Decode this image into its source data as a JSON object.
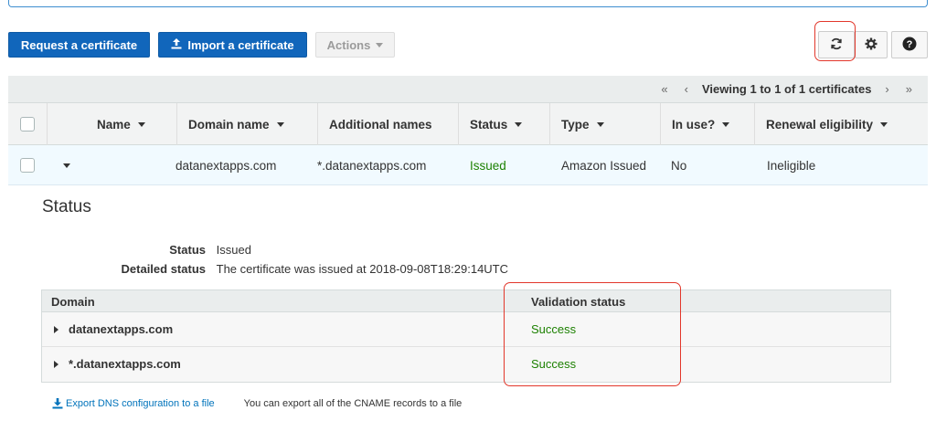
{
  "toolbar": {
    "request_label": "Request a certificate",
    "import_label": "Import a certificate",
    "actions_label": "Actions",
    "refresh_icon": "↻",
    "settings_icon": "✱",
    "help_icon": "?"
  },
  "pager": {
    "first": "«",
    "prev": "‹",
    "text": "Viewing 1 to 1 of 1 certificates",
    "next": "›",
    "last": "»"
  },
  "table": {
    "columns": [
      "Name",
      "Domain name",
      "Additional names",
      "Status",
      "Type",
      "In use?",
      "Renewal eligibility"
    ],
    "row": {
      "name": "",
      "domain": "datanextapps.com",
      "additional": "*.datanextapps.com",
      "status": "Issued",
      "type": "Amazon Issued",
      "in_use": "No",
      "renewal": "Ineligible"
    }
  },
  "detail": {
    "title": "Status",
    "status_key": "Status",
    "status_value": "Issued",
    "detailed_key": "Detailed status",
    "detailed_value": "The certificate was issued at 2018-09-08T18:29:14UTC",
    "validation": {
      "col_domain": "Domain",
      "col_status": "Validation status",
      "rows": [
        {
          "domain": "datanextapps.com",
          "status": "Success"
        },
        {
          "domain": "*.datanextapps.com",
          "status": "Success"
        }
      ]
    },
    "export_link": "Export DNS configuration to a file",
    "export_note": "You can export all of the CNAME records to a file"
  },
  "colors": {
    "primary": "#1166bb",
    "success": "#1d8102",
    "highlight": "#e2372b",
    "row_selected": "#f1faff"
  }
}
